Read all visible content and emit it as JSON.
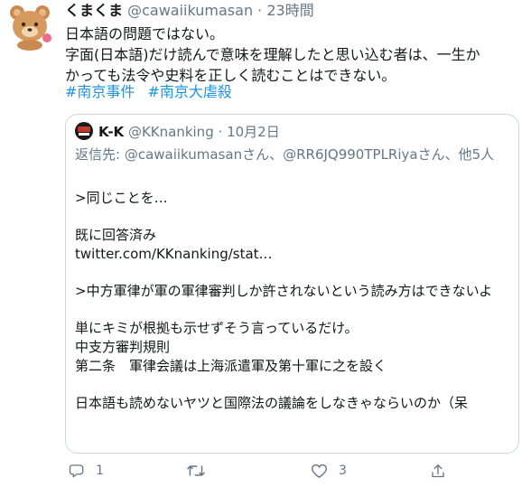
{
  "tweet": {
    "author_name": "くまくま",
    "author_handle": "@cawaiikumasan",
    "separator": "·",
    "time": "23時間",
    "text_lines": [
      "日本語の問題ではない。",
      "字面(日本語)だけ読んで意味を理解したと思い込む者は、一生か",
      "かっても法令や史料を正しく読むことはできない。"
    ],
    "hashtags": [
      "#南京事件",
      "#南京大虐殺"
    ],
    "avatar_icon": "bear-avatar-icon"
  },
  "quoted_tweet": {
    "author_name": "K-K",
    "author_handle": "@KKnanking",
    "separator": "·",
    "date": "10月2日",
    "avatar_icon": "kk-avatar-icon",
    "replying_to": "返信先: @cawaiikumasanさん、@RR6JQ990TPLRiyaさん、他5人",
    "lines": [
      ">同じことを…",
      "",
      "既に回答済み",
      "twitter.com/KKnanking/stat…",
      "",
      ">中方軍律が軍の軍律審判しか許されないという読み方はできないよ",
      "",
      "単にキミが根拠も示せずそう言っているだけ。",
      "中支方審判規則",
      "第二条　軍律会議は上海派遣軍及第十軍に之を設く",
      "",
      "日本語も読めないヤツと国際法の議論をしなきゃならいのか（呆"
    ]
  },
  "actions": {
    "reply_count": "1",
    "retweet_count": "",
    "like_count": "3",
    "icons": [
      "reply-icon",
      "retweet-icon",
      "like-icon",
      "share-icon"
    ]
  },
  "colors": {
    "link": "#1b95e0",
    "muted": "#657786",
    "text": "#14171a",
    "border": "#ccd6dd"
  }
}
